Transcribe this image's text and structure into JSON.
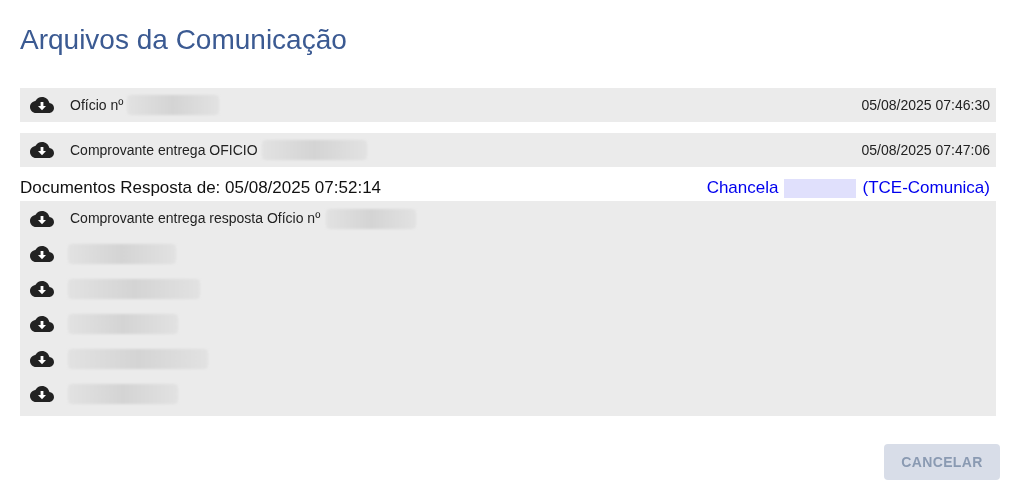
{
  "title": "Arquivos da Comunicação",
  "files": [
    {
      "name": "Ofício nº",
      "redacted": true,
      "date": "05/08/2025 07:46:30"
    },
    {
      "name": "Comprovante entrega OFICIO",
      "redacted": true,
      "date": "05/08/2025 07:47:06"
    }
  ],
  "response": {
    "heading": "Documentos Resposta de: 05/08/2025 07:52:14",
    "link_before": "Chancela",
    "link_redacted": true,
    "link_after": "(TCE-Comunica)",
    "files": [
      {
        "name": "Comprovante entrega resposta Ofício nº",
        "redacted": true
      },
      {
        "redacted": true
      },
      {
        "redacted": true
      },
      {
        "redacted": true
      },
      {
        "redacted": true
      },
      {
        "redacted": true
      }
    ]
  },
  "buttons": [
    {
      "label": "CANCELAR",
      "disabled": true
    }
  ]
}
